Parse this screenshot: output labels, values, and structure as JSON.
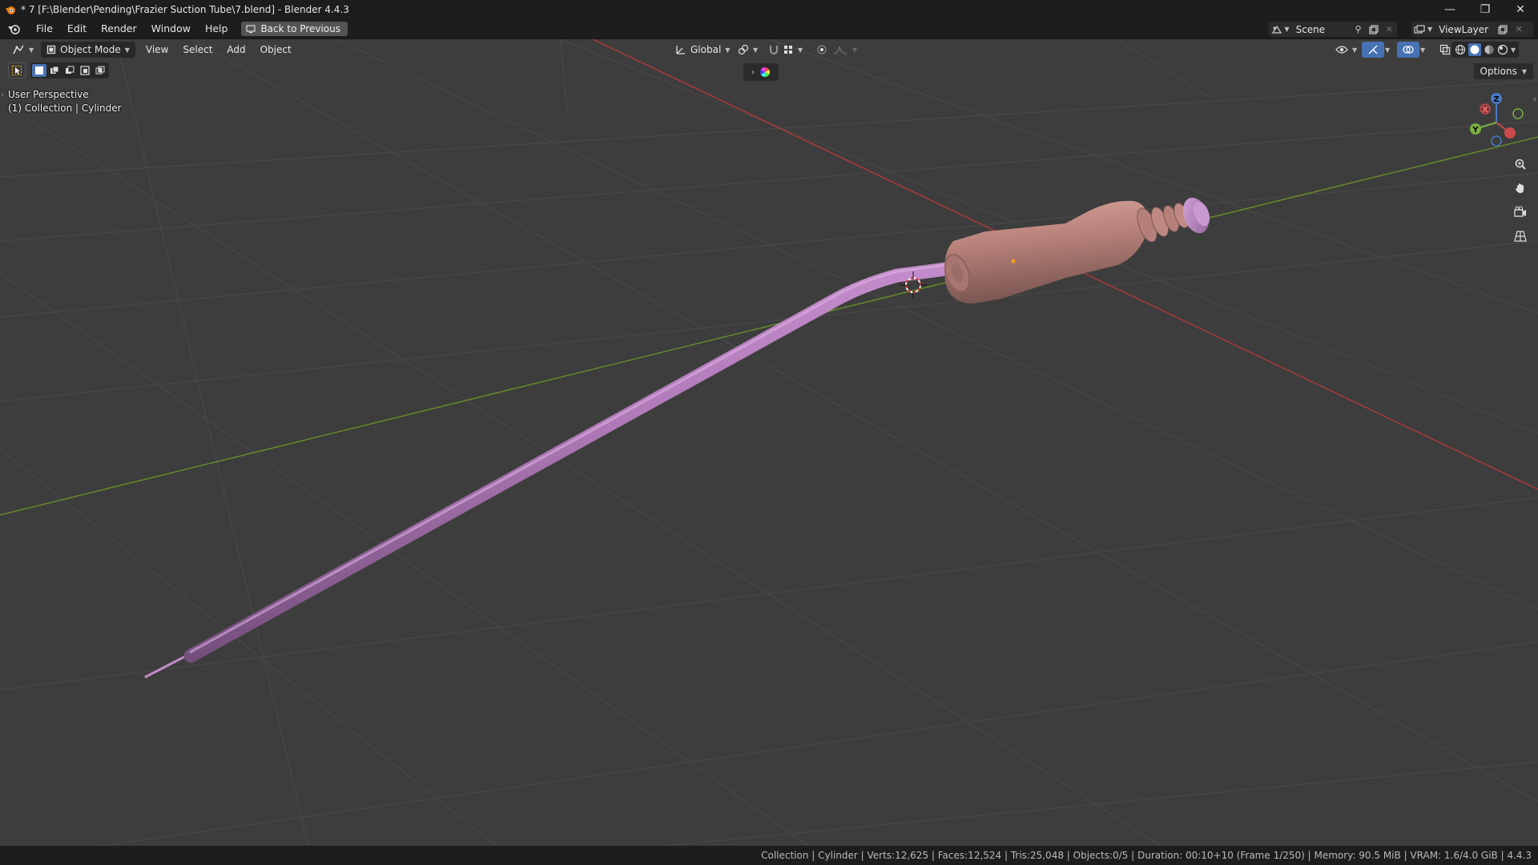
{
  "window": {
    "title": "* 7 [F:\\Blender\\Pending\\Frazier Suction Tube\\7.blend] - Blender 4.4.3",
    "minimize": "—",
    "maximize": "❐",
    "close": "✕"
  },
  "menubar": {
    "items": [
      "File",
      "Edit",
      "Render",
      "Window",
      "Help"
    ],
    "back_button": "Back to Previous",
    "scene_label": "Scene",
    "view_layer_label": "ViewLayer"
  },
  "viewport_header": {
    "mode": "Object Mode",
    "menus": [
      "View",
      "Select",
      "Add",
      "Object"
    ],
    "orientation": "Global",
    "options_label": "Options"
  },
  "viewport": {
    "perspective_label": "User Perspective",
    "collection_label": "(1) Collection | Cylinder",
    "gizmo_axes": {
      "x": "X",
      "y": "Y",
      "z": "Z"
    },
    "colors": {
      "background": "#3d3d3d",
      "grid": "#4a4a4a",
      "x_axis": "#b03a3a",
      "y_axis": "#6a8f2a",
      "tube": "#b07ab8",
      "handle": "#b7817a",
      "active_tool": "#4772b3"
    }
  },
  "statusbar": {
    "text": "Collection | Cylinder | Verts:12,625 | Faces:12,524 | Tris:25,048 | Objects:0/5 | Duration: 00:10+10 (Frame 1/250) | Memory: 90.5 MiB | VRAM: 1.6/4.0 GiB | 4.4.3"
  }
}
